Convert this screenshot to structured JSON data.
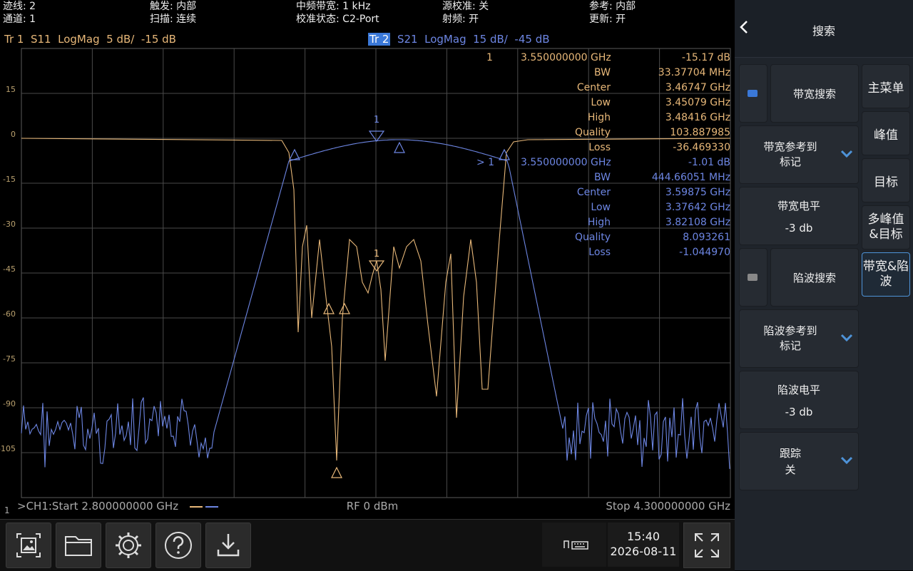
{
  "status": {
    "trace_count": "迹线: 2",
    "channel": "通道: 1",
    "trigger": "触发: 内部",
    "sweep": "扫描: 连续",
    "if_bw": "中频带宽: 1 kHz",
    "cal_state": "校准状态: C2-Port",
    "source_cal": "源校准: 关",
    "rf": "射频: 开",
    "reference": "参考: 内部",
    "update": "更新: 开"
  },
  "trace1": {
    "label": "Tr 1",
    "param": "S11",
    "format": "LogMag",
    "scale": "5 dB/",
    "ref": "-15 dB",
    "color": "#e8b879"
  },
  "trace2": {
    "label": "Tr 2",
    "param": "S21",
    "format": "LogMag",
    "scale": "15 dB/",
    "ref": "-45 dB",
    "color": "#6d86e3"
  },
  "y_ticks": [
    "15",
    "0",
    "-15",
    "-30",
    "-45",
    "-60",
    "-75",
    "-90",
    "-105"
  ],
  "marker1_tr1": {
    "id": "1",
    "freq": "3.550000000 GHz",
    "value": "-15.17 dB",
    "rows": [
      {
        "label": "BW",
        "value": "33.37704 MHz"
      },
      {
        "label": "Center",
        "value": "3.46747 GHz"
      },
      {
        "label": "Low",
        "value": "3.45079 GHz"
      },
      {
        "label": "High",
        "value": "3.48416 GHz"
      },
      {
        "label": "Quality",
        "value": "103.887985"
      },
      {
        "label": "Loss",
        "value": "-36.469330"
      }
    ]
  },
  "marker1_tr2": {
    "id": "> 1",
    "freq": "3.550000000 GHz",
    "value": "-1.01 dB",
    "rows": [
      {
        "label": "BW",
        "value": "444.66051 MHz"
      },
      {
        "label": "Center",
        "value": "3.59875 GHz"
      },
      {
        "label": "Low",
        "value": "3.37642 GHz"
      },
      {
        "label": "High",
        "value": "3.82108 GHz"
      },
      {
        "label": "Quality",
        "value": "8.093261"
      },
      {
        "label": "Loss",
        "value": "-1.044970"
      }
    ]
  },
  "footer": {
    "start": ">CH1:Start 2.800000000 GHz",
    "power": "RF 0 dBm",
    "stop": "Stop 4.300000000 GHz",
    "channel_num": "1"
  },
  "clock": {
    "time": "15:40",
    "date": "2026-08-11"
  },
  "panel": {
    "title": "搜索",
    "bw_search": "带宽搜索",
    "bw_ref_marker": "带宽参考到\n标记",
    "bw_level_label": "带宽电平",
    "bw_level_value": "-3 db",
    "notch_search": "陷波搜索",
    "notch_ref_marker": "陷波参考到\n标记",
    "notch_level_label": "陷波电平",
    "notch_level_value": "-3 db",
    "tracking_label": "跟踪",
    "tracking_value": "关",
    "side": [
      "主菜单",
      "峰值",
      "目标",
      "多峰值\n&目标",
      "带宽&陷\n波"
    ]
  },
  "colors": {
    "accent": "#4e93d8",
    "bw_led": "#3a78d8",
    "notch_led": "#888888",
    "grid": "#4a4a4a"
  }
}
